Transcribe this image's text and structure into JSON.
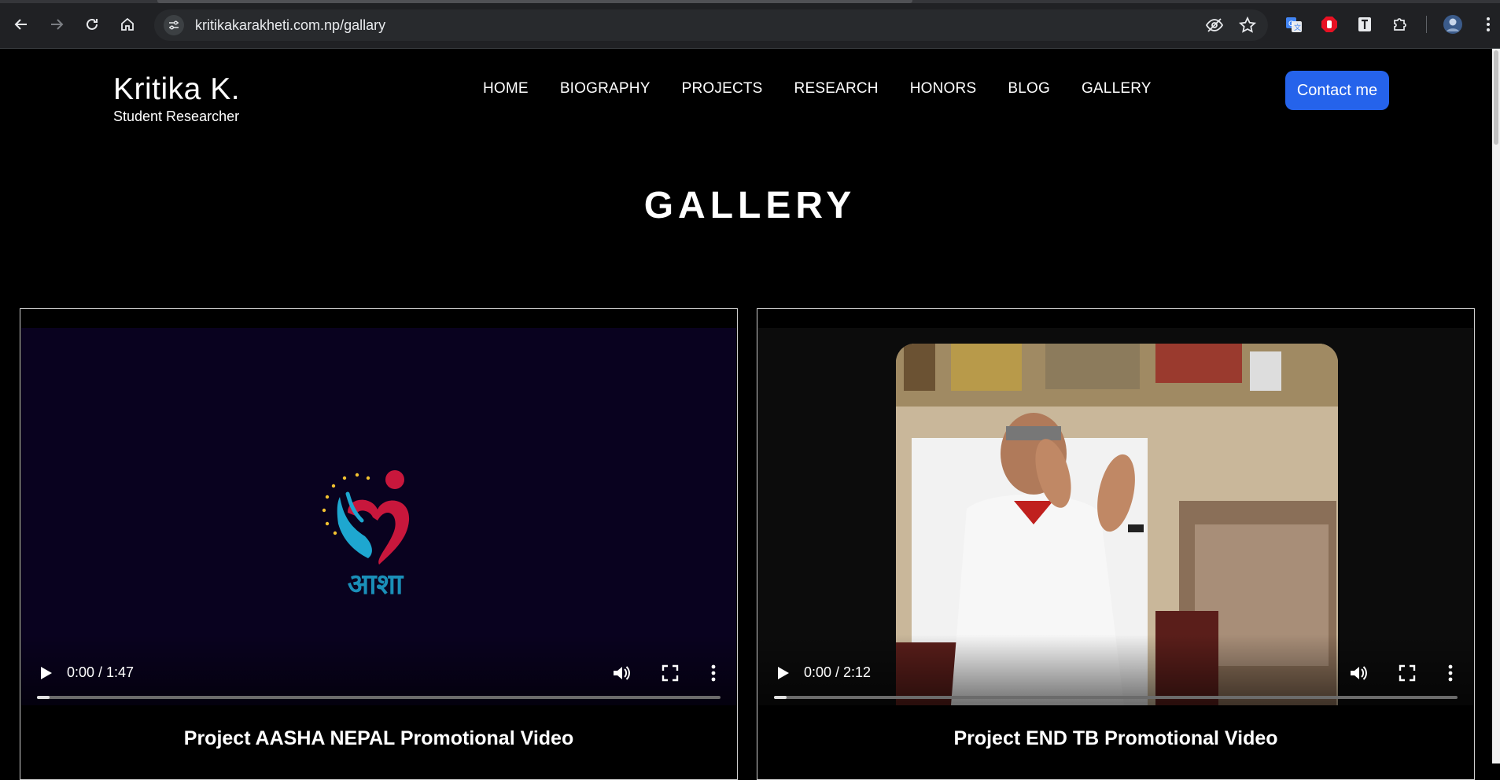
{
  "browser": {
    "url": "kritikakarakheti.com.np/gallary",
    "icons": [
      "back-icon",
      "forward-icon",
      "reload-icon",
      "home-icon",
      "site-settings-icon",
      "eye-off-icon",
      "star-icon",
      "translate-icon",
      "stop-hand-icon",
      "reader-icon",
      "extensions-icon",
      "profile-avatar"
    ]
  },
  "header": {
    "brand_name": "Kritika K.",
    "brand_subtitle": "Student Researcher",
    "nav": [
      "HOME",
      "BIOGRAPHY",
      "PROJECTS",
      "RESEARCH",
      "HONORS",
      "BLOG",
      "GALLERY"
    ],
    "contact_label": "Contact me",
    "accent_color": "#2563eb"
  },
  "page": {
    "title": "GALLERY"
  },
  "videos": [
    {
      "time": "0:00 / 1:47",
      "caption": "Project AASHA NEPAL Promotional Video",
      "logo_text": "आशा",
      "progress": 0
    },
    {
      "time": "0:00 / 2:12",
      "caption": "Project END TB Promotional Video",
      "progress": 0
    }
  ]
}
